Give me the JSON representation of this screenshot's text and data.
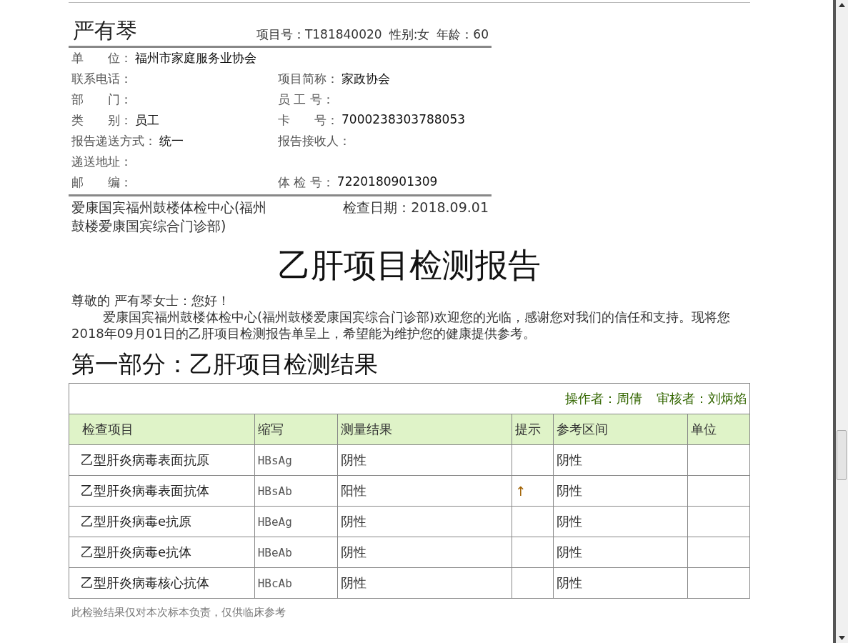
{
  "patient": {
    "name": "严有琴",
    "project_no": "项目号：T181840020",
    "gender": "性别:女",
    "age": "年龄：60"
  },
  "info_rows": [
    [
      {
        "label": "单　　位：",
        "value": "福州市家庭服务业协会"
      }
    ],
    [
      {
        "label": "联系电话："
      },
      {
        "label": "项目简称：",
        "value": "家政协会"
      }
    ],
    [
      {
        "label": "部　　门："
      },
      {
        "label": "员 工 号："
      }
    ],
    [
      {
        "label": "类　　别：",
        "value": "员工"
      },
      {
        "label": "卡　　号：",
        "value": "7000238303788053"
      }
    ],
    [
      {
        "label": "报告递送方式：",
        "value": "统一"
      },
      {
        "label": "报告接收人："
      }
    ],
    [
      {
        "label": "递送地址："
      }
    ],
    [
      {
        "label": "邮　　编："
      },
      {
        "label": "体 检 号：",
        "value": "7220180901309"
      }
    ]
  ],
  "clinic": "爱康国宾福州鼓楼体检中心(福州鼓楼爱康国宾综合门诊部)",
  "check_date": "检查日期：2018.09.01",
  "report_title": "乙肝项目检测报告",
  "greeting": "尊敬的 严有琴女士：您好！",
  "intro": "爱康国宾福州鼓楼体检中心(福州鼓楼爱康国宾综合门诊部)欢迎您的光临，感谢您对我们的信任和支持。现将您2018年09月01日的乙肝项目检测报告单呈上，希望能为维护您的健康提供参考。",
  "section_title": "第一部分：乙肝项目检测结果",
  "table": {
    "operator": "操作者：周倩",
    "reviewer": "审核者：刘炳焰",
    "columns": [
      "检查项目",
      "缩写",
      "测量结果",
      "提示",
      "参考区间",
      "单位"
    ],
    "rows": [
      {
        "item": "乙型肝炎病毒表面抗原",
        "abbr": "HBsAg",
        "result": "阴性",
        "reference": "阴性"
      },
      {
        "item": "乙型肝炎病毒表面抗体",
        "abbr": "HBsAb",
        "result": "阳性",
        "hint": "↑",
        "reference": "阴性"
      },
      {
        "item": "乙型肝炎病毒e抗原",
        "abbr": "HBeAg",
        "result": "阴性",
        "reference": "阴性"
      },
      {
        "item": "乙型肝炎病毒e抗体",
        "abbr": "HBeAb",
        "result": "阴性",
        "reference": "阴性"
      },
      {
        "item": "乙型肝炎病毒核心抗体",
        "abbr": "HBcAb",
        "result": "阴性",
        "reference": "阴性"
      }
    ]
  },
  "footnote": "此检验结果仅对本次标本负责，仅供临床参考"
}
